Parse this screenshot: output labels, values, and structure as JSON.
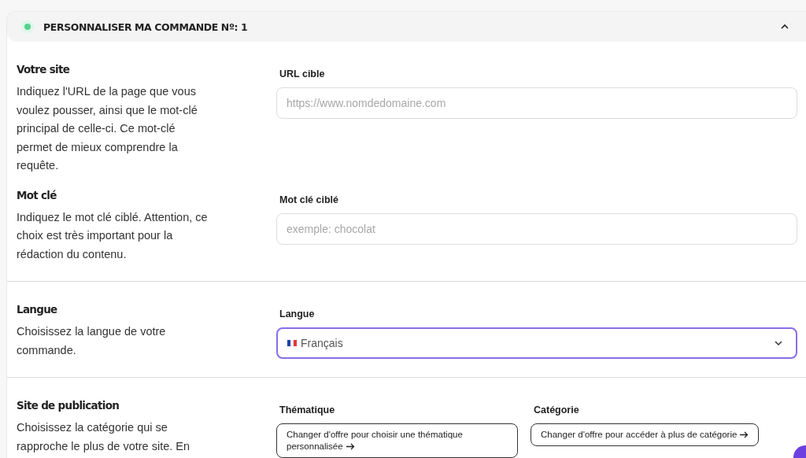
{
  "header": {
    "title": "PERSONNALISER MA COMMANDE Nº: 1",
    "expanded": true
  },
  "sections": [
    {
      "groups": [
        {
          "title": "Votre site",
          "description": "Indiquez l'URL de la page que vous voulez pousser, ainsi que le mot-clé principal de celle-ci. Ce mot-clé permet de mieux comprendre la requête.",
          "fields": [
            {
              "kind": "text",
              "label": "URL cible",
              "placeholder": "https://www.nomdedomaine.com"
            }
          ]
        },
        {
          "title": "Mot clé",
          "description": "Indiquez le mot clé ciblé. Attention, ce choix est très important pour la rédaction du contenu.",
          "fields": [
            {
              "kind": "text",
              "label": "Mot clé ciblé",
              "placeholder": "exemple: chocolat"
            }
          ]
        }
      ]
    },
    {
      "groups": [
        {
          "title": "Langue",
          "description": "Choisissez la langue de votre commande.",
          "fields": [
            {
              "kind": "select",
              "label": "Langue",
              "value": "Français",
              "focused": true
            }
          ]
        }
      ]
    },
    {
      "groups": [
        {
          "title": "Site de publication",
          "description": "Choisissez la catégorie qui se rapproche le plus de votre site. En",
          "fields": [
            {
              "kind": "offer",
              "label": "Thématique",
              "text": "Changer d'offre pour choisir une thématique personnalisée"
            },
            {
              "kind": "offer",
              "label": "Catégorie",
              "text": "Changer d'offre pour accéder à plus de catégorie"
            }
          ]
        }
      ]
    }
  ]
}
